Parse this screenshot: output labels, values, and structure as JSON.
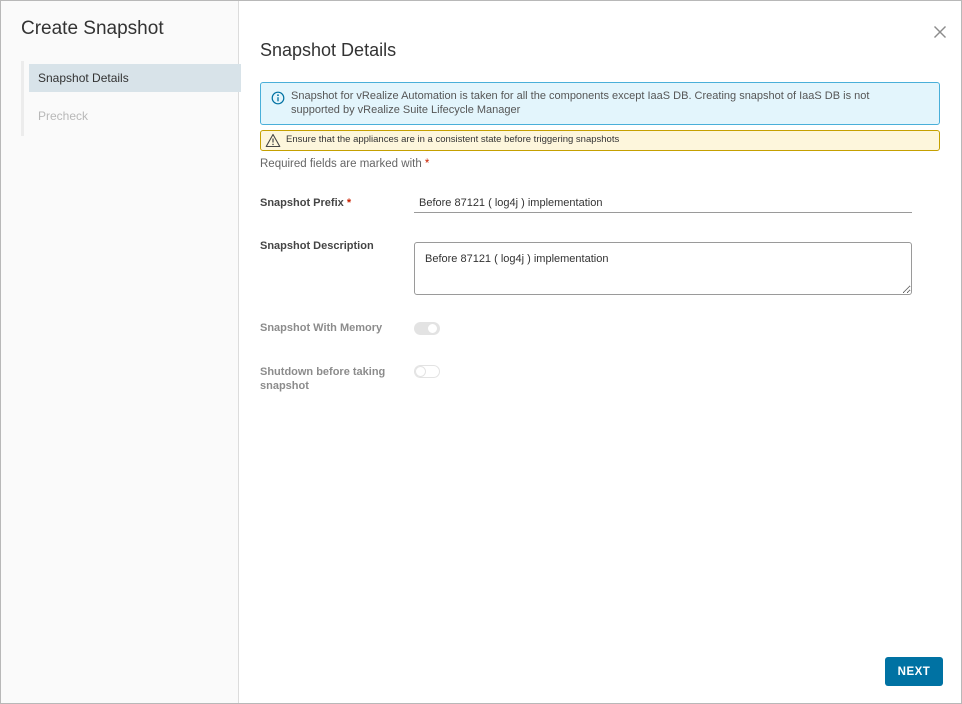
{
  "wizard": {
    "title": "Create Snapshot",
    "steps": [
      {
        "label": "Snapshot Details",
        "state": "active"
      },
      {
        "label": "Precheck",
        "state": "disabled"
      }
    ]
  },
  "main": {
    "title": "Snapshot Details",
    "info_alert": "Snapshot for vRealize Automation is taken for all the components except IaaS DB. Creating snapshot of IaaS DB is not supported by vRealize Suite Lifecycle Manager",
    "warning_alert": "Ensure that the appliances are in a consistent state before triggering snapshots",
    "required_note": "Required fields are marked with",
    "required_marker": "*"
  },
  "form": {
    "prefix_label": "Snapshot Prefix",
    "prefix_value": "Before 87121 ( log4j ) implementation",
    "description_label": "Snapshot Description",
    "description_value": "Before 87121 ( log4j ) implementation",
    "memory_label": "Snapshot With Memory",
    "memory_on": true,
    "shutdown_label_line1": "Shutdown before taking",
    "shutdown_label_line2": "snapshot",
    "shutdown_on": false
  },
  "footer": {
    "next_label": "NEXT"
  },
  "icons": {
    "close": "close-icon",
    "info": "info-circle-icon",
    "warning": "warning-triangle-icon"
  },
  "colors": {
    "primary": "#0072a3",
    "info_border": "#49afd9",
    "info_bg": "#e3f5fc",
    "warning_border": "#c5a000",
    "warning_bg": "#fdf6dc",
    "required": "#c92100",
    "active_step_bg": "#d8e3e9"
  }
}
